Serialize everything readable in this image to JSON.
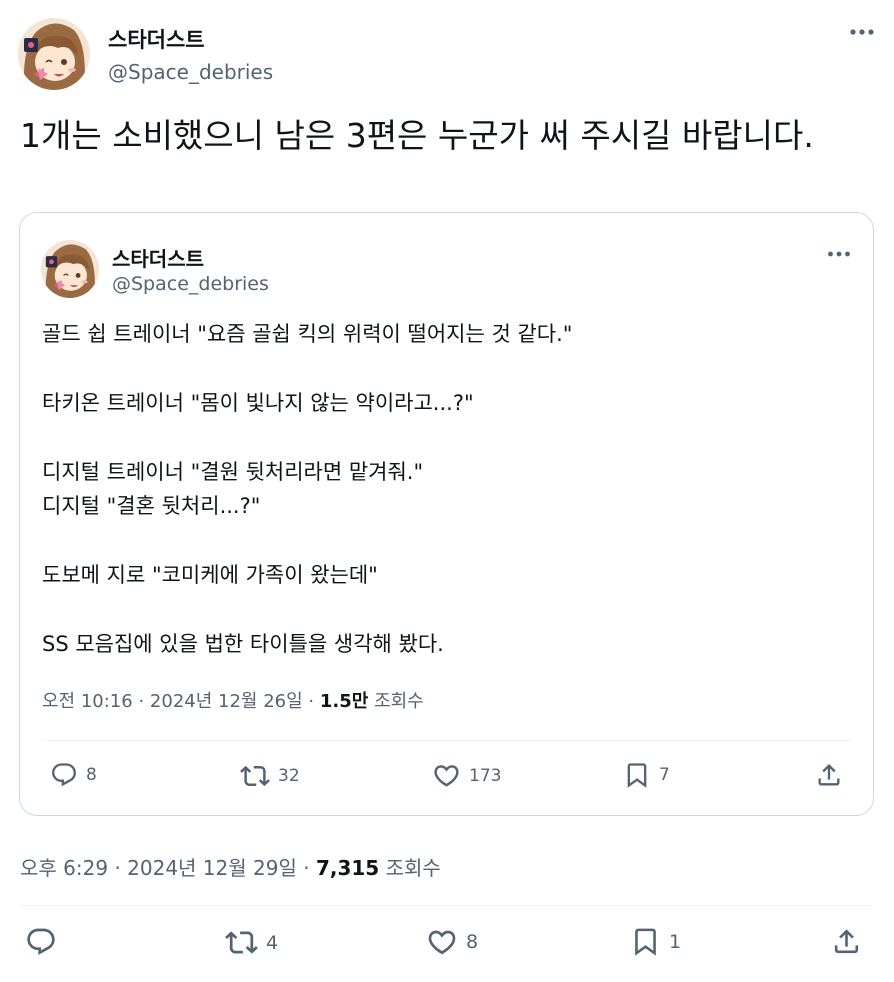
{
  "tweet": {
    "author": {
      "display_name": "스타더스트",
      "handle": "@Space_debries"
    },
    "text": "1개는 소비했으니 남은 3편은 누군가 써 주시길 바랍니다.",
    "meta": {
      "time": "오후 6:29",
      "date": "2024년 12월 29일",
      "views_count": "7,315",
      "views_label": "조회수",
      "separator": "·"
    },
    "actions": {
      "replies": "",
      "retweets": "4",
      "likes": "8",
      "bookmarks": "1"
    },
    "more_icon": "more-horizontal-icon"
  },
  "quoted_tweet": {
    "author": {
      "display_name": "스타더스트",
      "handle": "@Space_debries"
    },
    "lines": [
      "골드 쉽 트레이너 \"요즘 골쉽 킥의 위력이 떨어지는 것 같다.\"",
      "",
      "타키온 트레이너 \"몸이 빛나지 않는 약이라고...?\"",
      "",
      "디지털 트레이너 \"결원 뒷처리라면 맡겨줘.\"",
      "디지털 \"결혼 뒷처리...?\"",
      "",
      "도보메 지로 \"코미케에 가족이 왔는데\"",
      "",
      "SS 모음집에 있을 법한 타이틀을 생각해 봤다."
    ],
    "meta": {
      "time": "오전 10:16",
      "date": "2024년 12월 26일",
      "views_count": "1.5만",
      "views_label": "조회수",
      "separator": "·"
    },
    "actions": {
      "replies": "8",
      "retweets": "32",
      "likes": "173",
      "bookmarks": "7"
    }
  },
  "icons": {
    "reply": "reply-icon",
    "retweet": "retweet-icon",
    "like": "heart-icon",
    "bookmark": "bookmark-icon",
    "share": "share-icon",
    "more": "more-horizontal-icon"
  },
  "colors": {
    "text_primary": "#0f1419",
    "text_secondary": "#536471",
    "border": "#cfd9de",
    "divider": "#eff3f4"
  }
}
